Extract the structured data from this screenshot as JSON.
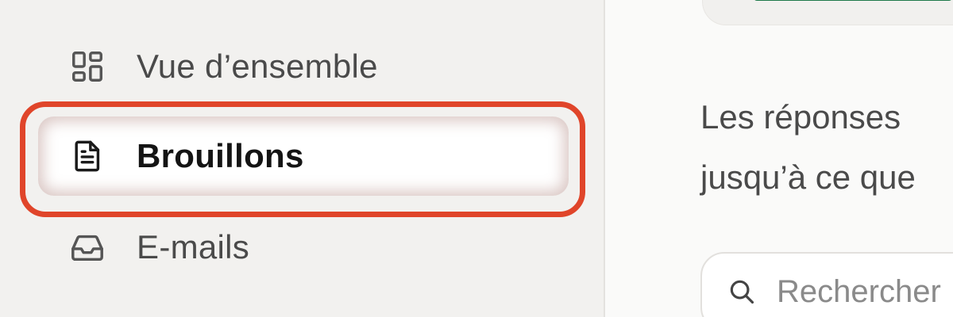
{
  "sidebar": {
    "items": [
      {
        "label": "Vue d’ensemble",
        "icon": "grid-icon",
        "active": false
      },
      {
        "label": "Brouillons",
        "icon": "document-icon",
        "active": true
      },
      {
        "label": "E-mails",
        "icon": "inbox-icon",
        "active": false
      }
    ]
  },
  "main": {
    "description_line1": "Les réponses",
    "description_line2": "jusqu’à ce que",
    "search": {
      "placeholder": "Rechercher",
      "value": ""
    }
  },
  "colors": {
    "highlight": "#e0452a",
    "accent_green": "#1f7a4a"
  }
}
